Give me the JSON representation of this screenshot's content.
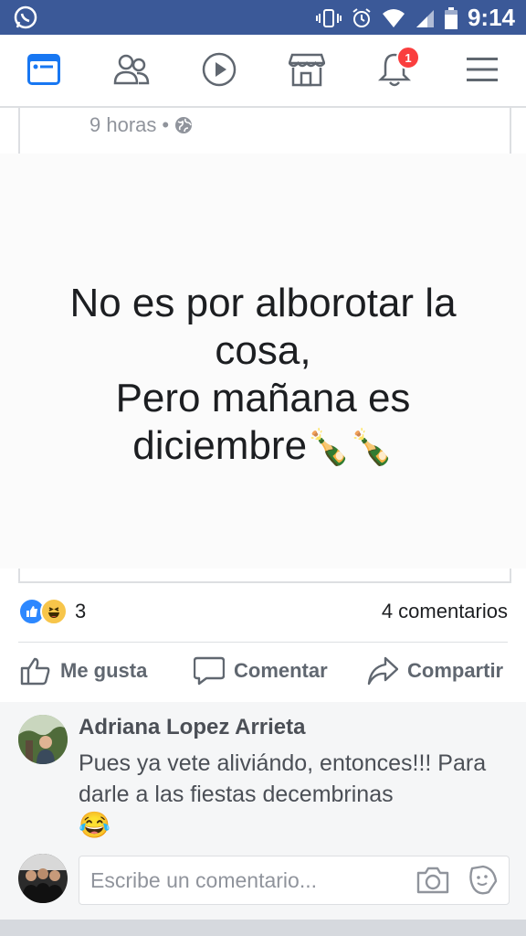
{
  "status_bar": {
    "time": "9:14",
    "icons": [
      "whatsapp-icon",
      "vibrate-icon",
      "alarm-icon",
      "wifi-icon",
      "signal-icon",
      "battery-icon"
    ]
  },
  "nav": {
    "icons": [
      "news-feed-icon",
      "friends-icon",
      "video-icon",
      "marketplace-icon",
      "notifications-icon",
      "menu-icon"
    ],
    "notification_count": "1"
  },
  "post": {
    "time": "9 horas",
    "separator": "•",
    "image_text": {
      "line1": "No es por alborotar la",
      "line2": "cosa,",
      "line3": "Pero mañana es",
      "line4": "diciembre",
      "emoji": "🍾🍾"
    },
    "reaction_count": "3",
    "comment_count": "4 comentarios",
    "actions": {
      "like": "Me gusta",
      "comment": "Comentar",
      "share": "Compartir"
    }
  },
  "comment": {
    "author": "Adriana Lopez Arrieta",
    "text": "Pues ya vete aliviándo, entonces!!! Para darle a las fiestas decembrinas",
    "emoji": "😂"
  },
  "composer": {
    "placeholder": "Escribe un comentario..."
  },
  "colors": {
    "brand": "#3b5998",
    "accent": "#1877f2",
    "badge": "#fa3e3e"
  }
}
